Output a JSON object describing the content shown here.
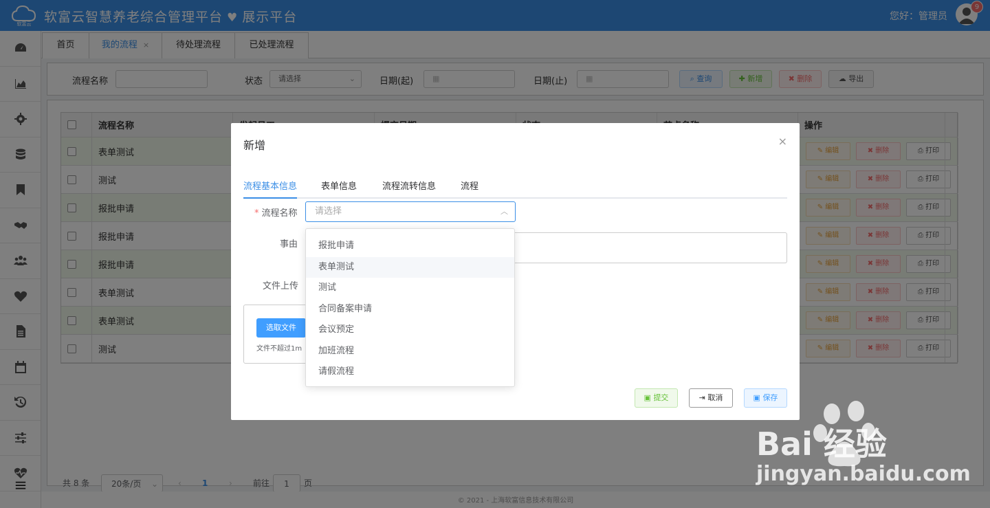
{
  "header": {
    "logo_text": "软富云",
    "title": "软富云智慧养老综合管理平台",
    "subtitle": "展示平台",
    "greeting": "您好：管理员",
    "badge_count": "9"
  },
  "sidebar": {
    "items": [
      "dashboard-icon",
      "chart-icon",
      "gear-icon",
      "database-icon",
      "bookmark-icon",
      "handshake-icon",
      "users-icon",
      "heart-icon",
      "document-icon",
      "calendar-icon",
      "history-icon",
      "sliders-icon",
      "heartbeat-icon"
    ]
  },
  "tabs": {
    "home": "首页",
    "my_flow": "我的流程",
    "my_flow_close": "×",
    "pending": "待处理流程",
    "processed": "已处理流程"
  },
  "search": {
    "name_label": "流程名称",
    "status_label": "状态",
    "status_value": "请选择",
    "date_from_label": "日期(起)",
    "date_to_label": "日期(止)",
    "query": "查询",
    "add": "新增",
    "delete": "删除",
    "export": "导出"
  },
  "table": {
    "headers": [
      "流程名称",
      "发起员工",
      "提交日期",
      "状态",
      "节点名称",
      "操作"
    ],
    "rows": [
      "表单测试",
      "测试",
      "报批申请",
      "报批申请",
      "报批申请",
      "表单测试",
      "表单测试",
      "测试"
    ],
    "ops": {
      "edit": "编辑",
      "delete": "删除",
      "print": "打印"
    }
  },
  "pager": {
    "total": "共 8 条",
    "page_size": "20条/页",
    "current": "1",
    "goto": "前往",
    "goto_value": "1",
    "page_unit": "页",
    "prev": "‹",
    "next": "›"
  },
  "footer": "© 2021 - 上海软富信息技术有限公司",
  "modal": {
    "title": "新增",
    "close": "×",
    "tabs": [
      "流程基本信息",
      "表单信息",
      "流程流转信息",
      "流程"
    ],
    "required_mark": "*",
    "flow_name_label": "流程名称",
    "flow_name_placeholder": "请选择",
    "reason_label": "事由",
    "upload_label": "文件上传",
    "upload_button": "选取文件",
    "upload_tip": "文件不超过1m",
    "submit": "提交",
    "cancel": "取消",
    "save": "保存"
  },
  "dropdown": {
    "options": [
      "报批申请",
      "表单测试",
      "测试",
      "合同备案申请",
      "会议预定",
      "加班流程",
      "请假流程"
    ]
  },
  "watermark": {
    "brand": "Bai 经验",
    "url": "jingyan.baidu.com"
  },
  "colors": {
    "primary": "#3a8ee6",
    "success": "#67c23a",
    "danger": "#f56c6c",
    "warning": "#e6a23c"
  }
}
